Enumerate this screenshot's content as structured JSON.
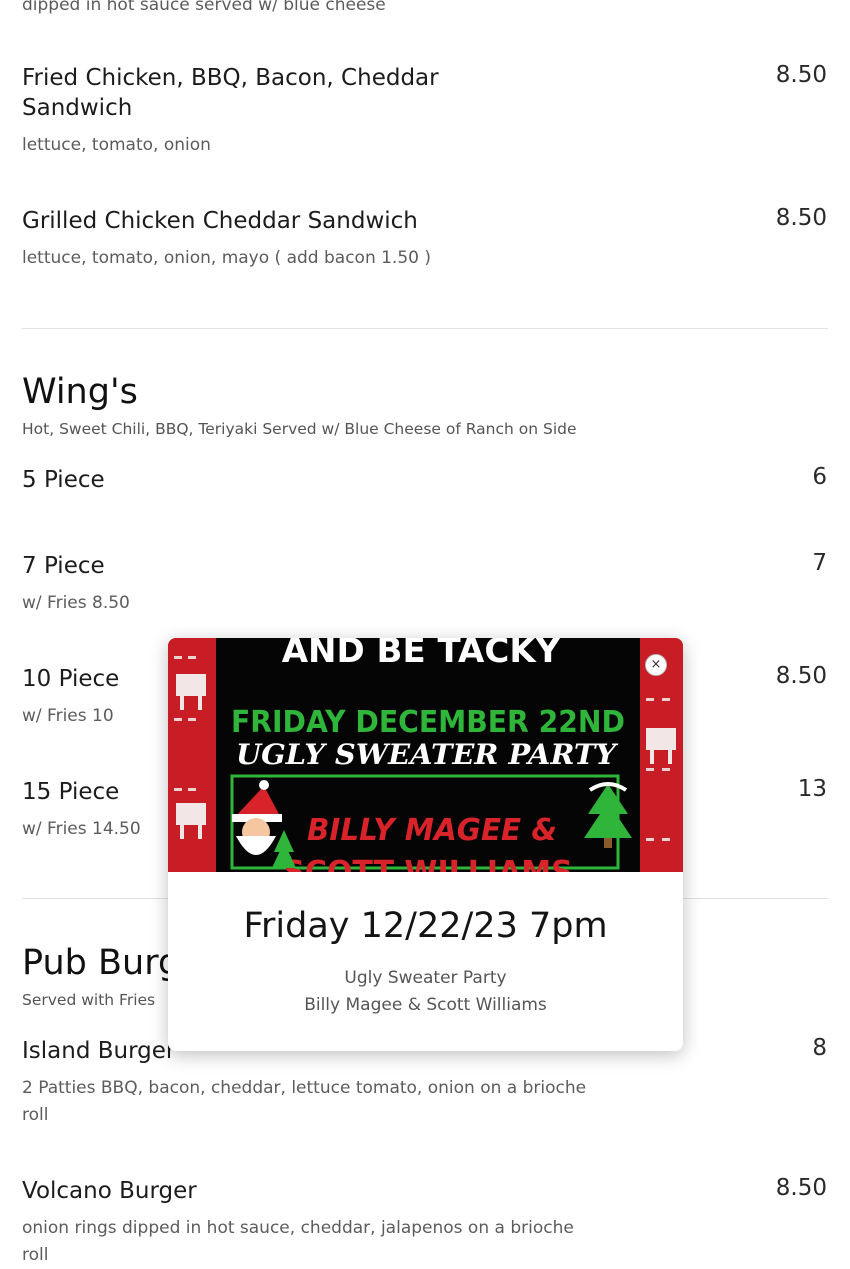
{
  "top_partial": {
    "text": "dipped in hot sauce served w/ blue cheese"
  },
  "sandwiches": [
    {
      "name_line1": "Fried Chicken, BBQ, Bacon, Cheddar",
      "name_line2": "Sandwich",
      "desc": "lettuce, tomato, onion",
      "price": "8.50"
    },
    {
      "name": "Grilled Chicken Cheddar Sandwich",
      "desc": "lettuce, tomato, onion, mayo ( add bacon 1.50 )",
      "price": "8.50"
    }
  ],
  "wings": {
    "title": "Wing's",
    "subtitle": "Hot, Sweet Chili, BBQ, Teriyaki Served w/ Blue Cheese of Ranch on Side",
    "items": [
      {
        "name": "5 Piece",
        "desc": "",
        "price": "6"
      },
      {
        "name": "7 Piece",
        "desc": "w/ Fries 8.50",
        "price": "7"
      },
      {
        "name": "10 Piece",
        "desc": "w/ Fries 10",
        "price": "8.50"
      },
      {
        "name": "15 Piece",
        "desc": "w/ Fries 14.50",
        "price": "13"
      }
    ]
  },
  "burgers": {
    "title": "Pub Burgers",
    "subtitle": "Served with Fries",
    "items": [
      {
        "name": "Island Burger",
        "desc_line1": "2 Patties BBQ, bacon, cheddar, lettuce tomato, onion on a brioche",
        "desc_line2": "roll",
        "price": "8"
      },
      {
        "name": "Volcano Burger",
        "desc_line1": "onion rings dipped in hot sauce, cheddar, jalapenos  on a brioche",
        "desc_line2": "roll",
        "price": "8.50"
      }
    ]
  },
  "modal": {
    "poster": {
      "line_top": "AND BE TACKY",
      "line_date": "FRIDAY DECEMBER 22ND",
      "line_event": "UGLY SWEATER PARTY",
      "line_artist1": "BILLY MAGEE &",
      "line_artist2": "SCOTT WILLIAMS"
    },
    "close_symbol": "×",
    "title": "Friday 12/22/23 7pm",
    "line1": "Ugly Sweater Party",
    "line2": "Billy Magee & Scott Williams"
  },
  "colors": {
    "poster_red": "#c81d25",
    "poster_green": "#2fb53a",
    "poster_black": "#050505"
  }
}
